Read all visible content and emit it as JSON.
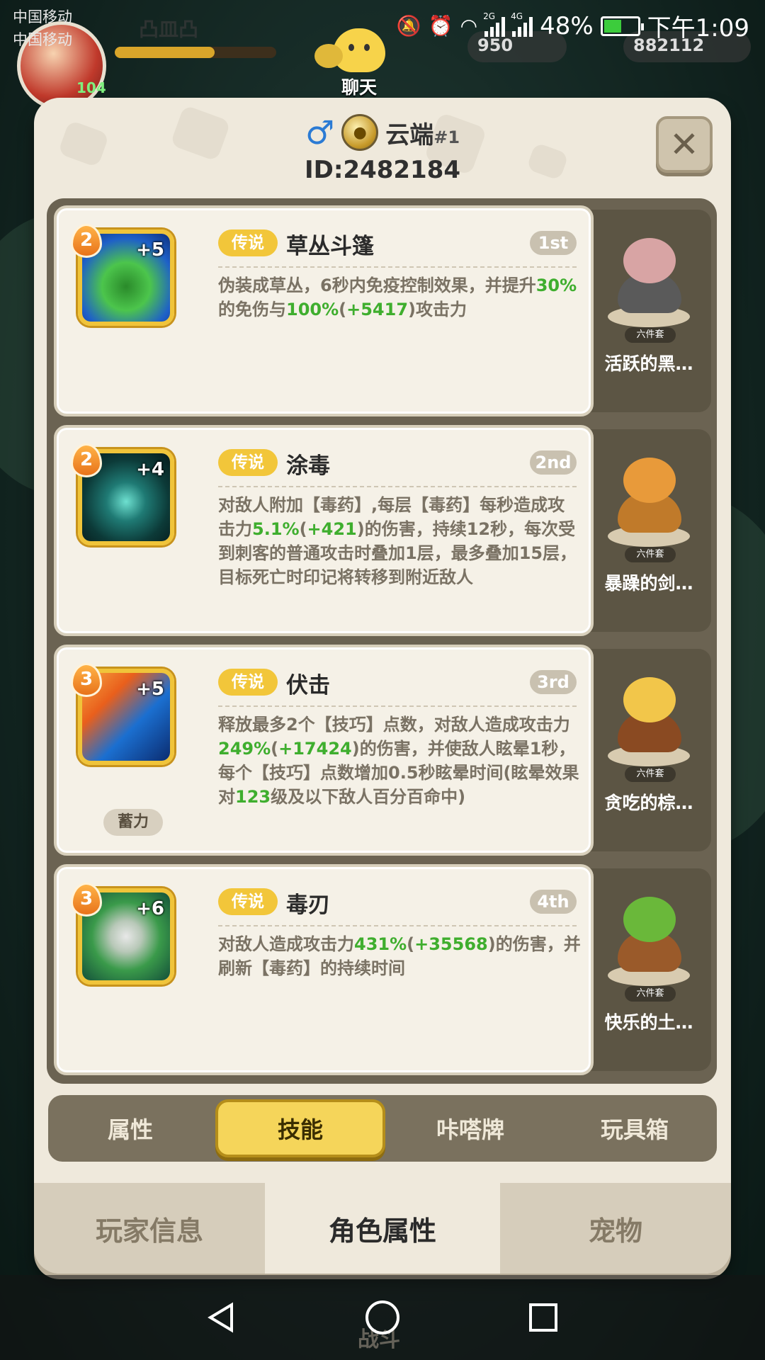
{
  "status": {
    "carrier1": "中国移动",
    "carrier2": "中国移动",
    "battery": "48%",
    "time": "下午1:09",
    "net2g": "2G",
    "net4g": "4G"
  },
  "hud": {
    "name": "凸皿凸",
    "level": "104",
    "gold": "950",
    "gems": "882112",
    "chat": "聊天",
    "fight": "战斗"
  },
  "profile": {
    "name": "云端",
    "rank": "#1",
    "id": "ID:2482184"
  },
  "skills": [
    {
      "level": "2",
      "plus": "+5",
      "tag": "传说",
      "name": "草丛斗篷",
      "order": "1st",
      "desc": [
        "伪装成草丛，6秒内免疫控制效果，并提升",
        "30%",
        "的免伤与",
        "100%",
        "(",
        "+5417",
        ")攻击力"
      ],
      "pet": "活跃的黑…",
      "set": "六件套"
    },
    {
      "level": "2",
      "plus": "+4",
      "tag": "传说",
      "name": "涂毒",
      "order": "2nd",
      "desc": [
        "对敌人附加【毒药】,每层【毒药】每秒造成攻击力",
        "5.1%",
        "(",
        "+421",
        ")的伤害，持续12秒，每次受到刺客的普通攻击时叠加1层，最多叠加15层，目标死亡时印记将转移到附近敌人"
      ],
      "pet": "暴躁的剑…",
      "set": "六件套"
    },
    {
      "level": "3",
      "plus": "+5",
      "tag": "传说",
      "name": "伏击",
      "order": "3rd",
      "charge": "蓄力",
      "desc": [
        "释放最多2个【技巧】点数，对敌人造成攻击力",
        "249%",
        "(",
        "+17424",
        ")的伤害，并使敌人眩晕1秒，每个【技巧】点数增加0.5秒眩晕时间(眩晕效果对",
        "123",
        "级及以下敌人百分百命中)"
      ],
      "pet": "贪吃的棕…",
      "set": "六件套"
    },
    {
      "level": "3",
      "plus": "+6",
      "tag": "传说",
      "name": "毒刃",
      "order": "4th",
      "desc": [
        "对敌人造成攻击力",
        "431%",
        "(",
        "+35568",
        ")的伤害，并刷新【毒药】的持续时间"
      ],
      "pet": "快乐的土…",
      "set": "六件套"
    }
  ],
  "tabs": [
    "属性",
    "技能",
    "咔嗒牌",
    "玩具箱"
  ],
  "bottom_tabs": [
    "玩家信息",
    "角色属性",
    "宠物"
  ],
  "colors": {
    "accent": "#f2c63a",
    "highlight": "#3fae2e",
    "panel": "#efe9dc"
  }
}
